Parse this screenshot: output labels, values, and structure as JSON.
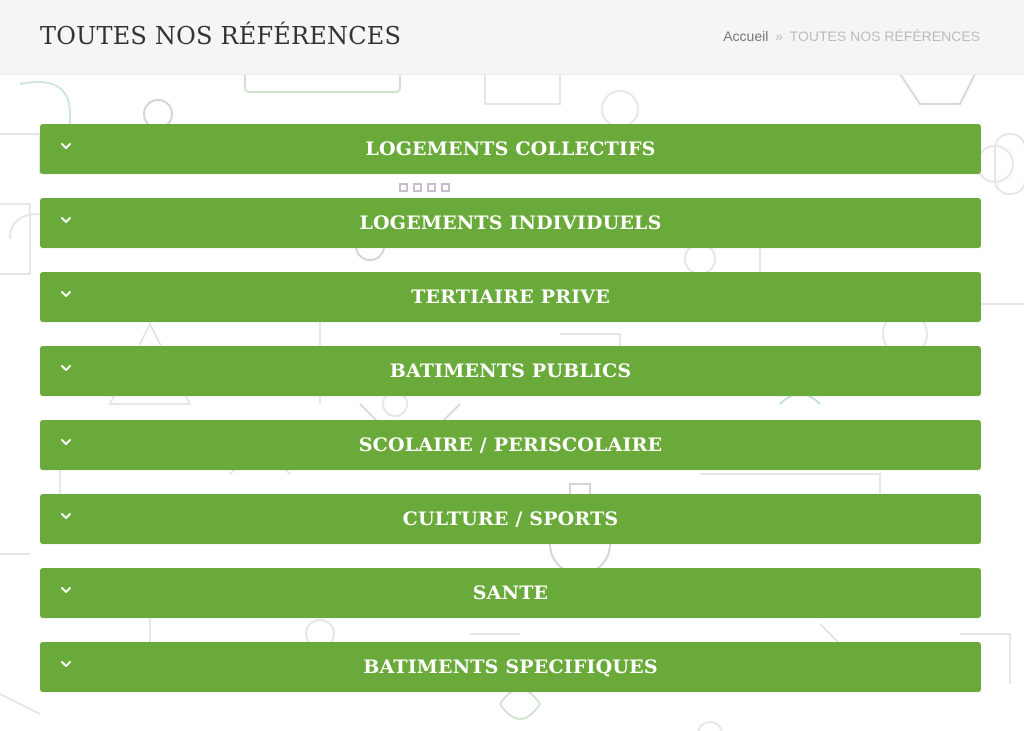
{
  "header": {
    "title": "TOUTES NOS RÉFÉRENCES",
    "breadcrumb": {
      "home": "Accueil",
      "separator": "»",
      "current": "TOUTES NOS RÉFÉRENCES"
    }
  },
  "accordion": {
    "items": [
      {
        "label": "LOGEMENTS COLLECTIFS",
        "icon": "chevron-down-icon"
      },
      {
        "label": "LOGEMENTS INDIVIDUELS",
        "icon": "chevron-down-icon"
      },
      {
        "label": "TERTIAIRE PRIVE",
        "icon": "chevron-down-icon"
      },
      {
        "label": "BATIMENTS PUBLICS",
        "icon": "chevron-down-icon"
      },
      {
        "label": "SCOLAIRE / PERISCOLAIRE",
        "icon": "chevron-down-icon"
      },
      {
        "label": "CULTURE / SPORTS",
        "icon": "chevron-down-icon"
      },
      {
        "label": "SANTE",
        "icon": "chevron-down-icon"
      },
      {
        "label": "BATIMENTS SPECIFIQUES",
        "icon": "chevron-down-icon"
      }
    ]
  },
  "colors": {
    "accent": "#6aaa3a",
    "header_bg": "#f5f5f5",
    "title": "#333333",
    "breadcrumb_link": "#777777",
    "breadcrumb_current": "#bbbbbb"
  }
}
